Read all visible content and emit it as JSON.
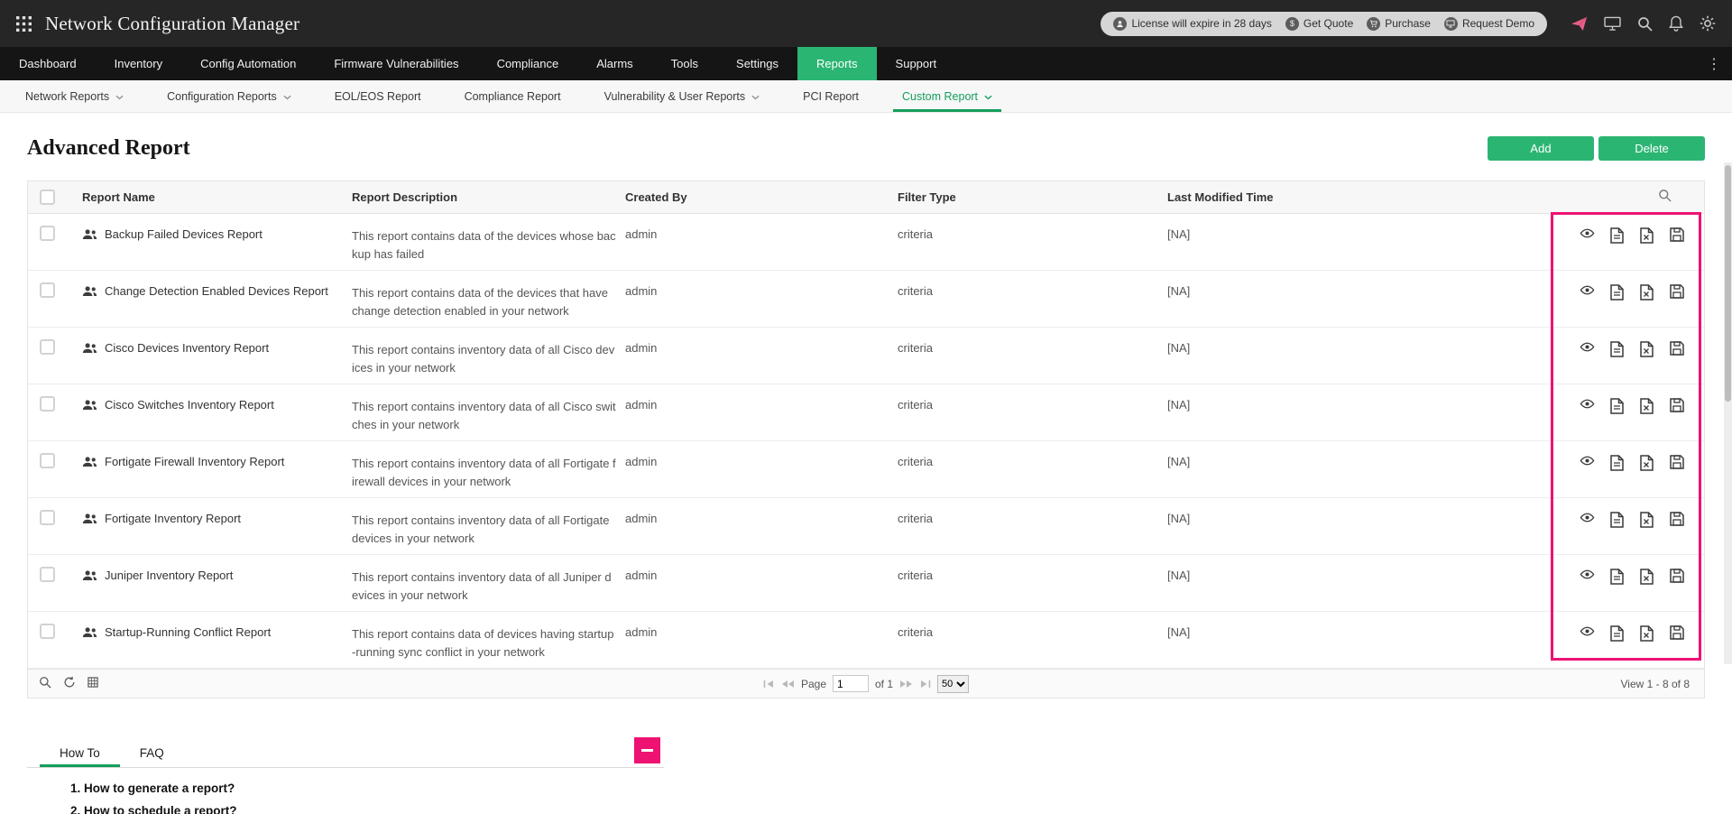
{
  "app": {
    "title": "Network Configuration Manager"
  },
  "topbar": {
    "license_text": "License will expire in 28 days",
    "get_quote": "Get Quote",
    "purchase": "Purchase",
    "request_demo": "Request Demo"
  },
  "nav": {
    "items": [
      {
        "label": "Dashboard"
      },
      {
        "label": "Inventory"
      },
      {
        "label": "Config Automation"
      },
      {
        "label": "Firmware Vulnerabilities"
      },
      {
        "label": "Compliance"
      },
      {
        "label": "Alarms"
      },
      {
        "label": "Tools"
      },
      {
        "label": "Settings"
      },
      {
        "label": "Reports",
        "active": true
      },
      {
        "label": "Support"
      }
    ]
  },
  "subnav": {
    "items": [
      {
        "label": "Network Reports",
        "dropdown": true
      },
      {
        "label": "Configuration Reports",
        "dropdown": true
      },
      {
        "label": "EOL/EOS Report"
      },
      {
        "label": "Compliance Report"
      },
      {
        "label": "Vulnerability & User Reports",
        "dropdown": true
      },
      {
        "label": "PCI Report"
      },
      {
        "label": "Custom Report",
        "dropdown": true,
        "active": true
      }
    ]
  },
  "page": {
    "title": "Advanced Report",
    "add_label": "Add",
    "delete_label": "Delete"
  },
  "table": {
    "columns": {
      "name": "Report Name",
      "description": "Report Description",
      "created_by": "Created By",
      "filter_type": "Filter Type",
      "last_modified": "Last Modified Time"
    },
    "rows": [
      {
        "name": "Backup Failed Devices Report",
        "description": "This report contains data of the devices whose backup has failed",
        "created_by": "admin",
        "filter_type": "criteria",
        "last_modified": "[NA]"
      },
      {
        "name": "Change Detection Enabled Devices Report",
        "description": "This report contains data of the devices that have change detection enabled in your network",
        "created_by": "admin",
        "filter_type": "criteria",
        "last_modified": "[NA]"
      },
      {
        "name": "Cisco Devices Inventory Report",
        "description": "This report contains inventory data of all Cisco devices in your network",
        "created_by": "admin",
        "filter_type": "criteria",
        "last_modified": "[NA]"
      },
      {
        "name": "Cisco Switches Inventory Report",
        "description": "This report contains inventory data of all Cisco switches in your network",
        "created_by": "admin",
        "filter_type": "criteria",
        "last_modified": "[NA]"
      },
      {
        "name": "Fortigate Firewall Inventory Report",
        "description": "This report contains inventory data of all Fortigate firewall devices in your network",
        "created_by": "admin",
        "filter_type": "criteria",
        "last_modified": "[NA]"
      },
      {
        "name": "Fortigate Inventory Report",
        "description": "This report contains inventory data of all Fortigate devices in your network",
        "created_by": "admin",
        "filter_type": "criteria",
        "last_modified": "[NA]"
      },
      {
        "name": "Juniper Inventory Report",
        "description": "This report contains inventory data of all Juniper devices in your network",
        "created_by": "admin",
        "filter_type": "criteria",
        "last_modified": "[NA]"
      },
      {
        "name": "Startup-Running Conflict Report",
        "description": "This report contains data of devices having startup-running sync conflict in your network",
        "created_by": "admin",
        "filter_type": "criteria",
        "last_modified": "[NA]"
      }
    ]
  },
  "pagination": {
    "page_label": "Page",
    "current_page": "1",
    "of_label": "of 1",
    "page_size": "50",
    "view_text": "View 1 - 8 of 8"
  },
  "help": {
    "tabs": [
      {
        "label": "How To",
        "active": true
      },
      {
        "label": "FAQ"
      }
    ],
    "items": [
      {
        "text": "1. How to generate a report?"
      },
      {
        "text": "2. How to schedule a report?"
      }
    ]
  },
  "colors": {
    "accent_green": "#2bb573",
    "highlight_pink": "#ee1273"
  }
}
